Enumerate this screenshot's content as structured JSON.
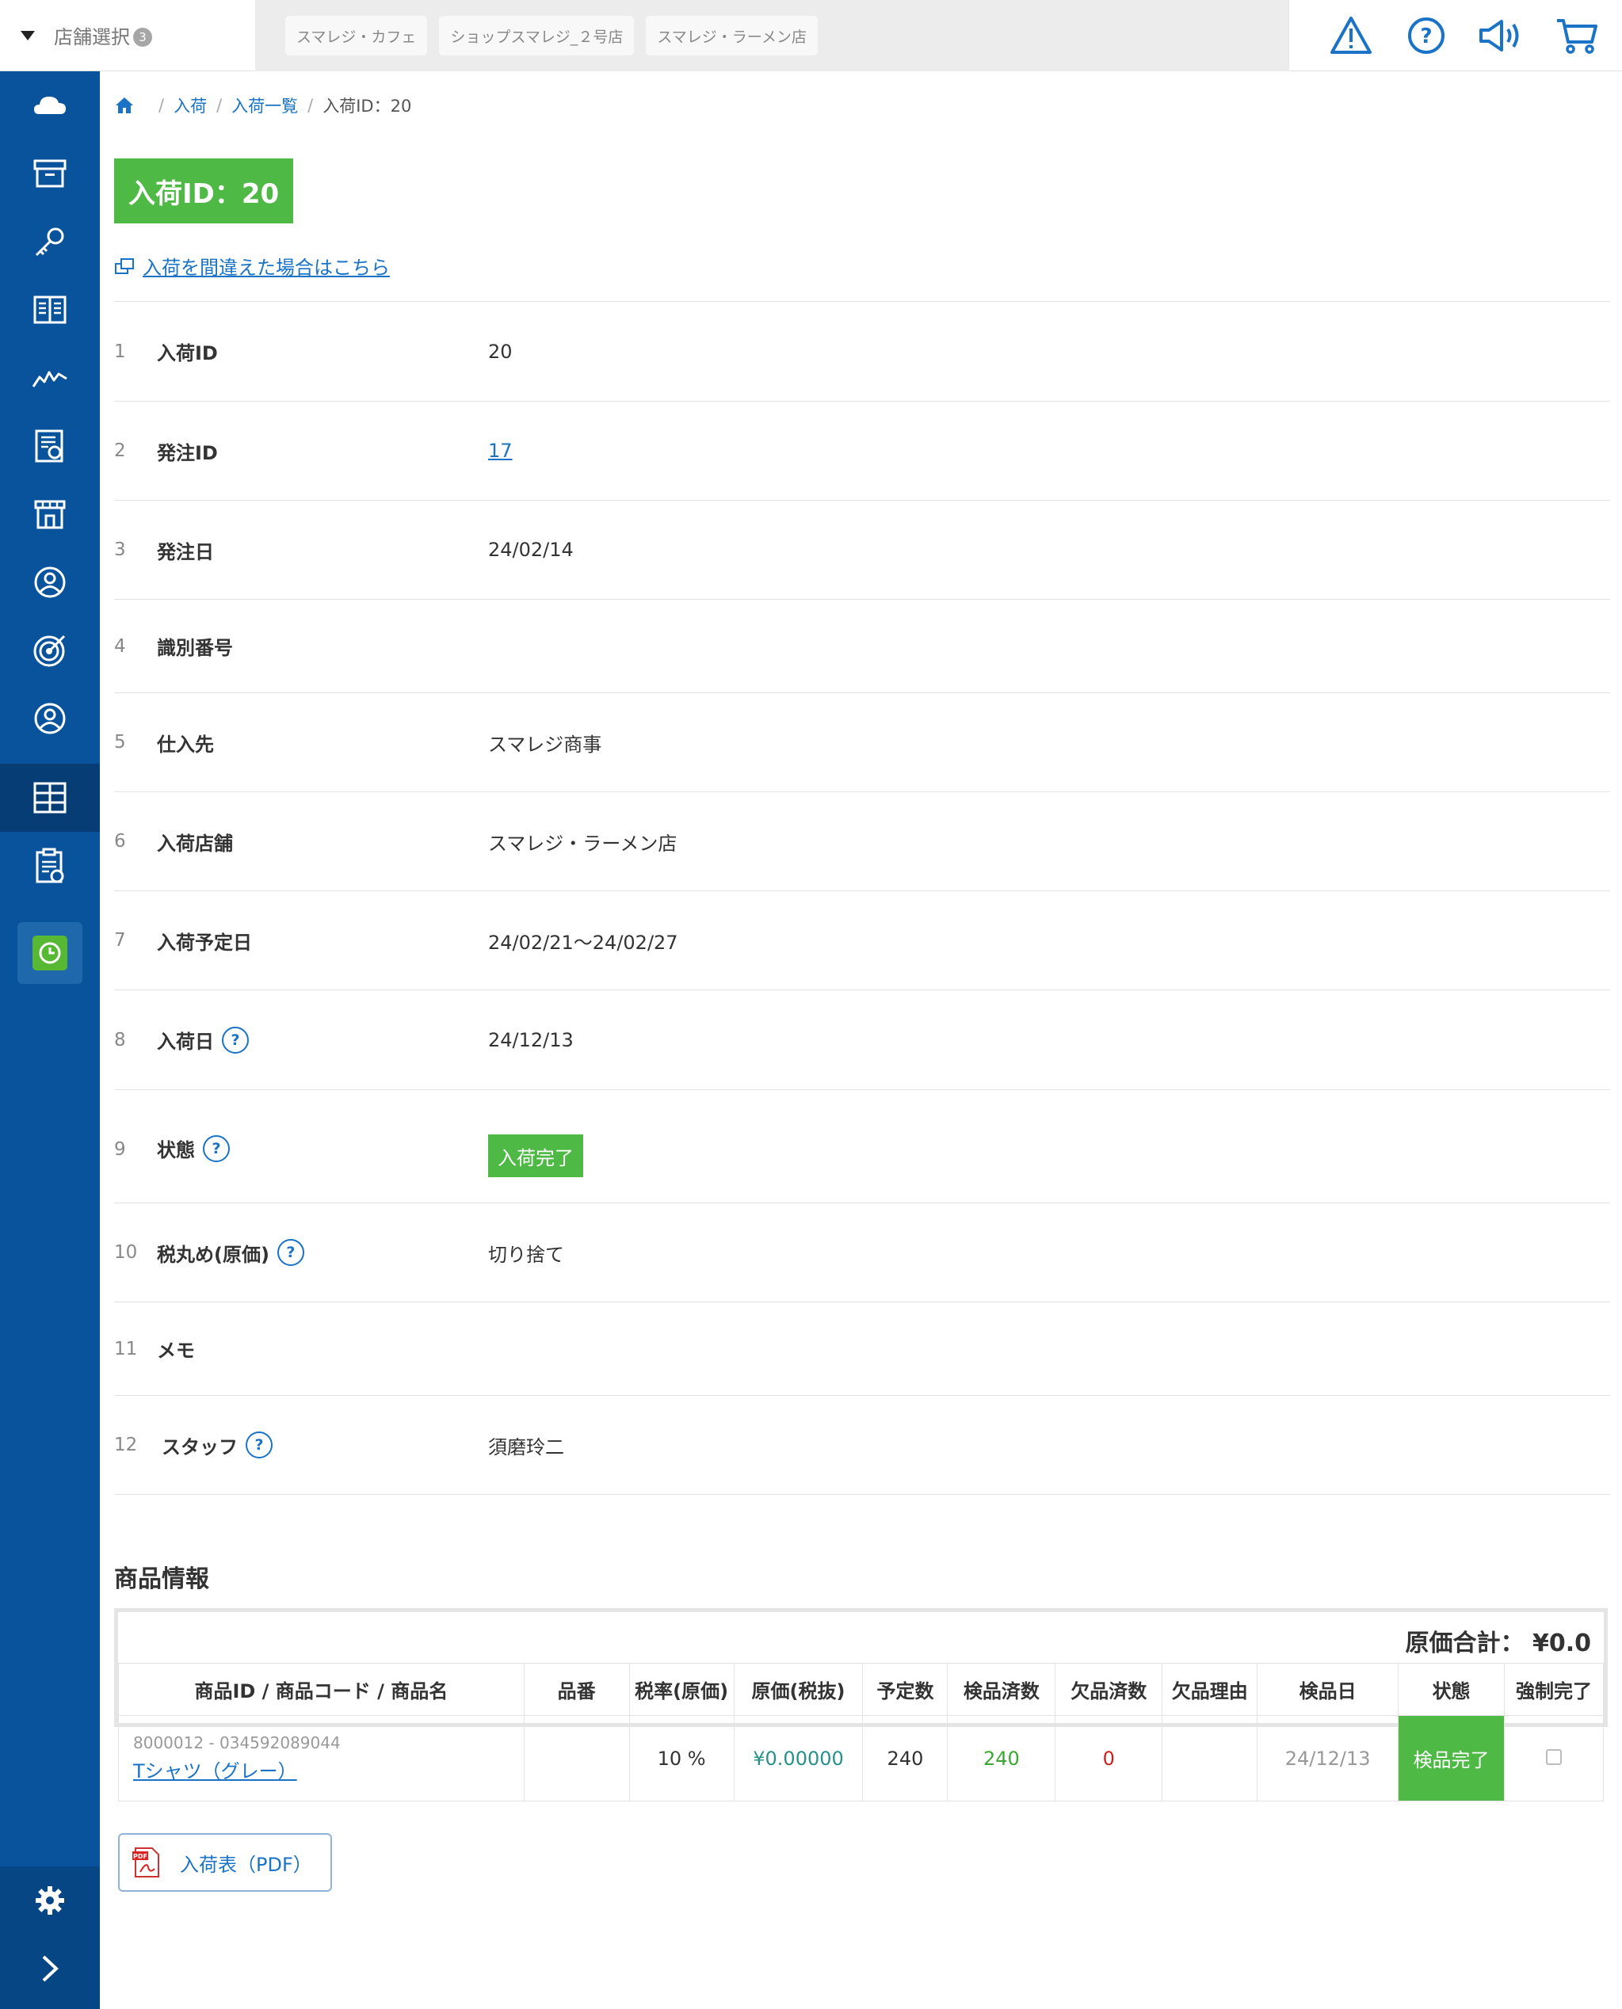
{
  "topbar": {
    "store_select_label": "店舗選択",
    "store_count": "3",
    "store_tabs": [
      "スマレジ・カフェ",
      "ショップスマレジ_２号店",
      "スマレジ・ラーメン店"
    ],
    "icons": [
      "warning-icon",
      "help-icon",
      "megaphone-icon",
      "cart-icon"
    ]
  },
  "sidebar": {
    "items": [
      "cloud-icon",
      "archive-box-icon",
      "key-icon",
      "book-icon",
      "chart-line-icon",
      "report-icon",
      "store-icon",
      "user-icon",
      "target-icon",
      "user-circle-icon",
      "grid-icon",
      "clipboard-icon",
      "clock-icon"
    ],
    "active_item": "grid-icon",
    "bottom": [
      "gear-icon",
      "chevron-right-icon"
    ]
  },
  "breadcrumb": {
    "items": [
      "入荷",
      "入荷一覧"
    ],
    "current": "入荷ID：20"
  },
  "page_title": "入荷ID：20",
  "mistake_link": "入荷を間違えた場合はこちら",
  "details": [
    {
      "num": "1",
      "key": "入荷ID",
      "value": "20"
    },
    {
      "num": "2",
      "key": "発注ID",
      "value": "17"
    },
    {
      "num": "3",
      "key": "発注日",
      "value": "24/02/14"
    },
    {
      "num": "4",
      "key": "識別番号",
      "value": ""
    },
    {
      "num": "5",
      "key": "仕入先",
      "value": "スマレジ商事"
    },
    {
      "num": "6",
      "key": "入荷店舗",
      "value": "スマレジ・ラーメン店"
    },
    {
      "num": "7",
      "key": "入荷予定日",
      "value": "24/02/21〜24/02/27"
    },
    {
      "num": "8",
      "key": "入荷日",
      "value": "24/12/13"
    },
    {
      "num": "9",
      "key": "状態",
      "value": "入荷完了"
    },
    {
      "num": "10",
      "key": "税丸め(原価)",
      "value": "切り捨て"
    },
    {
      "num": "11",
      "key": "メモ",
      "value": ""
    },
    {
      "num": "12",
      "key": "スタッフ",
      "value": "須磨玲二"
    }
  ],
  "help_mark": "?",
  "products": {
    "section_title": "商品情報",
    "cost_total": "原価合計： ¥0.0",
    "columns": [
      "商品ID / 商品コード / 商品名",
      "品番",
      "税率(原価)",
      "原価(税抜)",
      "予定数",
      "検品済数",
      "欠品済数",
      "欠品理由",
      "検品日",
      "状態",
      "強制完了"
    ],
    "rows": [
      {
        "code": "8000012 - 034592089044",
        "name": "Tシャツ（グレー）",
        "part_no": "",
        "tax_rate": "10 %",
        "cost": "¥0.00000",
        "planned": "240",
        "inspected": "240",
        "shortage": "0",
        "shortage_reason": "",
        "inspect_date": "24/12/13",
        "state": "検品完了"
      }
    ]
  },
  "pdf_button": "入荷表（PDF）",
  "colors": {
    "sidebar": "#08539b",
    "accent_green": "#4fb946",
    "link_blue": "#1a73c6"
  }
}
